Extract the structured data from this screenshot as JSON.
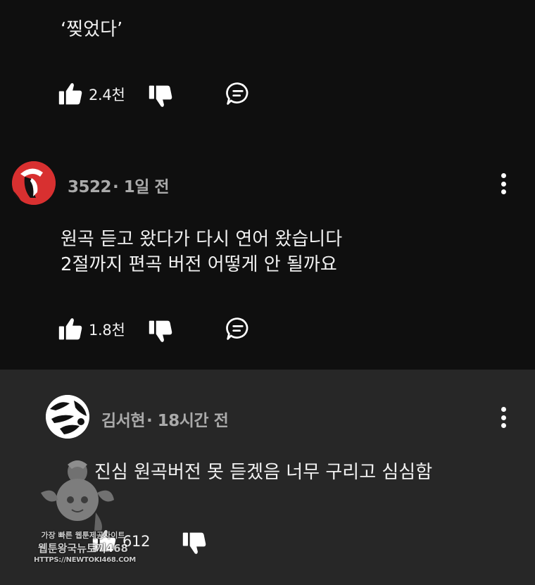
{
  "comments": [
    {
      "text": "‘찢었다’",
      "likes": "2.4천"
    },
    {
      "author": "3522",
      "time": "· 1일 전",
      "text": "원곡 듣고 왔다가 다시 연어 왔습니다\n2절까지 편곡 버전 어떻게 안 될까요",
      "likes": "1.8천"
    },
    {
      "author": "김서현",
      "time": "· 18시간 전",
      "text": "진심 원곡버전 못 듣겠음 너무 구리고 심심함",
      "likes": "612"
    }
  ],
  "watermark": {
    "line1": "가장 빠른 웹툰제공사이트",
    "line2": "웹툰왕국뉴토끼468",
    "line3": "HTTPS://NEWTOKI468.COM"
  },
  "icons": {
    "like": "thumbs-up-icon",
    "dislike": "thumbs-down-icon",
    "reply": "comment-bubble-icon",
    "more": "more-vertical-icon"
  },
  "colors": {
    "background": "#0f0f0f",
    "highlighted_background": "#272727",
    "meta_text": "#aaaaaa"
  }
}
